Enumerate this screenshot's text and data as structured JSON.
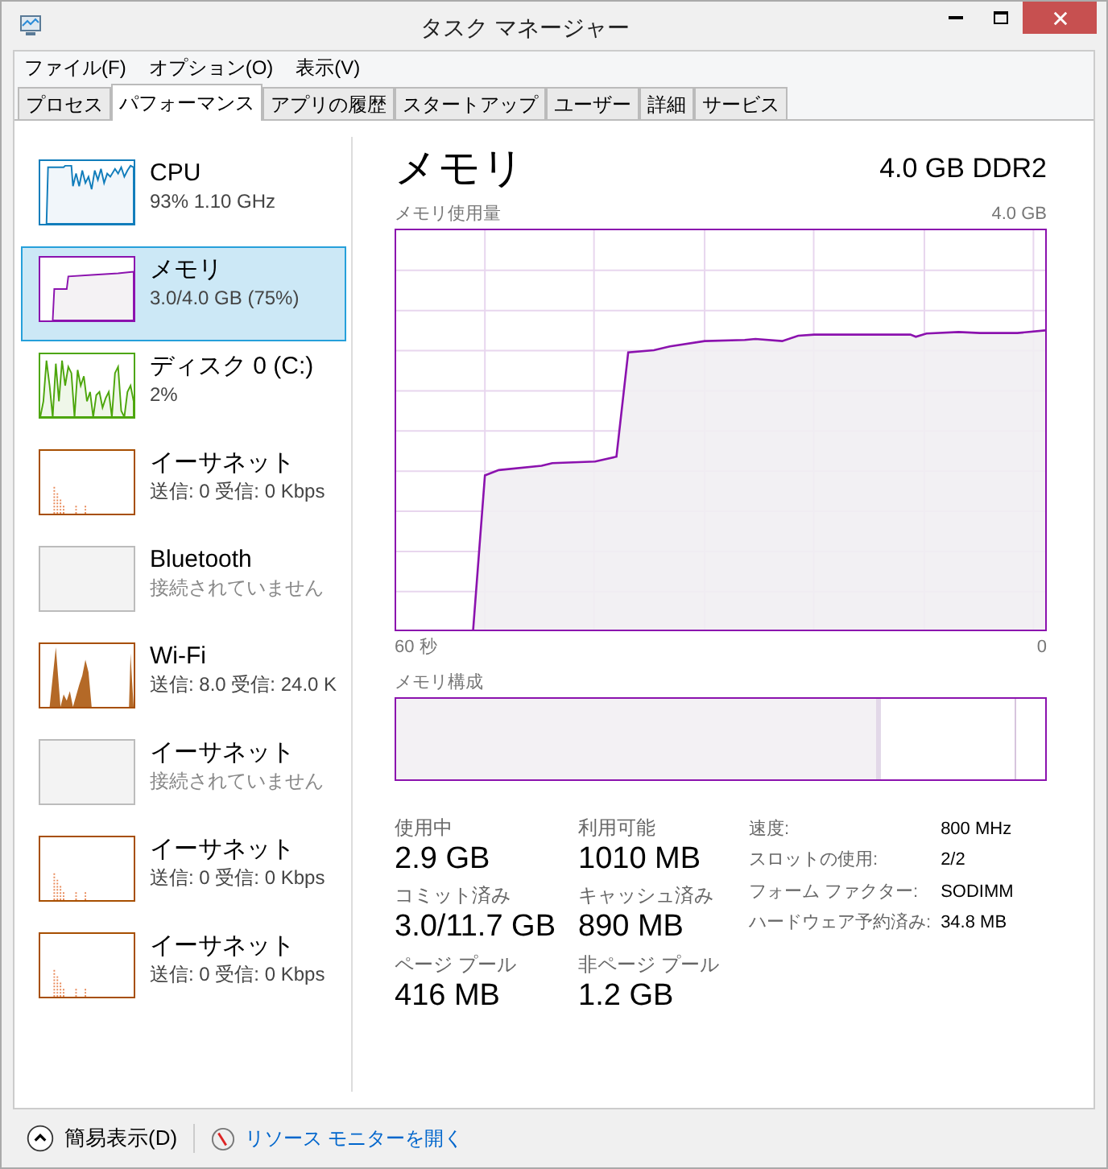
{
  "window": {
    "title": "タスク マネージャー"
  },
  "menu": [
    "ファイル(F)",
    "オプション(O)",
    "表示(V)"
  ],
  "tabs": [
    {
      "label": "プロセス",
      "selected": false
    },
    {
      "label": "パフォーマンス",
      "selected": true
    },
    {
      "label": "アプリの履歴",
      "selected": false
    },
    {
      "label": "スタートアップ",
      "selected": false
    },
    {
      "label": "ユーザー",
      "selected": false
    },
    {
      "label": "詳細",
      "selected": false
    },
    {
      "label": "サービス",
      "selected": false
    }
  ],
  "sidebar": {
    "items": [
      {
        "kind": "cpu",
        "color": "#117dbb",
        "name": "CPU",
        "detail": "93% 1.10 GHz",
        "selected": false
      },
      {
        "kind": "memory",
        "color": "#8b12ae",
        "name": "メモリ",
        "detail": "3.0/4.0 GB (75%)",
        "selected": true
      },
      {
        "kind": "disk",
        "color": "#4da60c",
        "name": "ディスク 0 (C:)",
        "detail": "2%",
        "selected": false
      },
      {
        "kind": "network",
        "color": "#a74f01",
        "name": "イーサネット",
        "detail": "送信: 0 受信: 0 Kbps",
        "selected": false
      },
      {
        "kind": "empty",
        "color": "#bcbcbc",
        "name": "Bluetooth",
        "detail": "接続されていません",
        "selected": false
      },
      {
        "kind": "wifi",
        "color": "#a74f01",
        "name": "Wi-Fi",
        "detail": "送信: 8.0 受信: 24.0 K",
        "selected": false
      },
      {
        "kind": "empty",
        "color": "#bcbcbc",
        "name": "イーサネット",
        "detail": "接続されていません",
        "selected": false
      },
      {
        "kind": "network",
        "color": "#a74f01",
        "name": "イーサネット",
        "detail": "送信: 0 受信: 0 Kbps",
        "selected": false
      },
      {
        "kind": "network",
        "color": "#a74f01",
        "name": "イーサネット",
        "detail": "送信: 0 受信: 0 Kbps",
        "selected": false
      }
    ]
  },
  "panel": {
    "title": "メモリ",
    "spec": "4.0 GB DDR2",
    "usage_label": "メモリ使用量",
    "usage_max": "4.0 GB",
    "x_start": "60 秒",
    "x_end": "0",
    "composition_label": "メモリ構成",
    "stats": [
      {
        "label": "使用中",
        "value": "2.9 GB"
      },
      {
        "label": "利用可能",
        "value": "1010 MB"
      },
      {
        "label": "コミット済み",
        "value": "3.0/11.7 GB"
      },
      {
        "label": "キャッシュ済み",
        "value": "890 MB"
      },
      {
        "label": "ページ プール",
        "value": "416 MB"
      },
      {
        "label": "非ページ プール",
        "value": "1.2 GB"
      }
    ],
    "details": [
      {
        "label": "速度:",
        "value": "800 MHz"
      },
      {
        "label": "スロットの使用:",
        "value": "2/2"
      },
      {
        "label": "フォーム ファクター:",
        "value": "SODIMM"
      },
      {
        "label": "ハードウェア予約済み:",
        "value": "34.8 MB"
      }
    ]
  },
  "footer": {
    "fewer_details": "簡易表示(D)",
    "resource_monitor": "リソース モニターを開く"
  }
}
